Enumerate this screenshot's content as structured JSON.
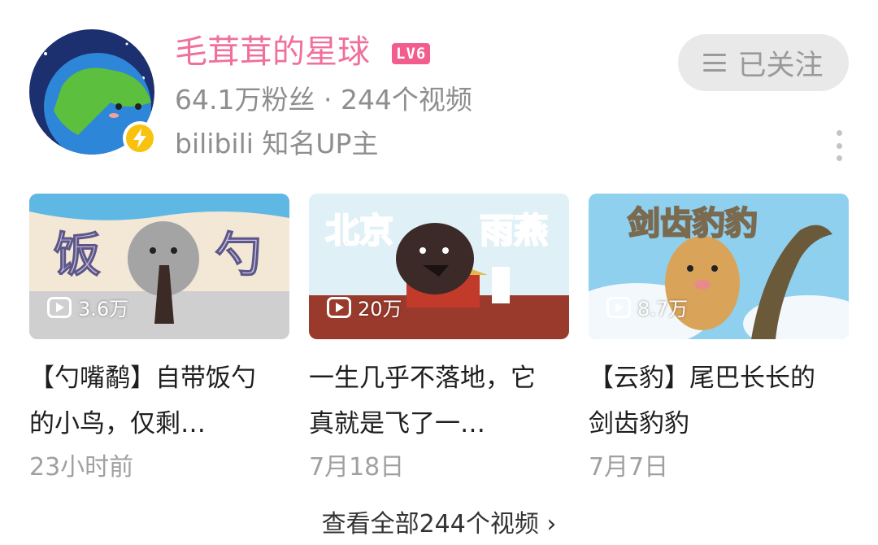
{
  "channel": {
    "name": "毛茸茸的星球",
    "level": "LV6",
    "stats": "64.1万粉丝 · 244个视频",
    "verification": "bilibili 知名UP主",
    "badge_icon": "lightning-icon",
    "follow_label": "已关注"
  },
  "videos": [
    {
      "thumb_text": [
        "饭",
        "勺"
      ],
      "views": "3.6万",
      "title": "【勺嘴鹬】自带饭勺的小鸟，仅剩…",
      "date": "23小时前"
    },
    {
      "thumb_text": [
        "北京",
        "雨燕"
      ],
      "views": "20万",
      "title": "一生几乎不落地，它真就是飞了一…",
      "date": "7月18日"
    },
    {
      "thumb_text": [
        "剑齿豹豹"
      ],
      "views": "8.7万",
      "title": "【云豹】尾巴长长的剑齿豹豹",
      "date": "7月7日"
    }
  ],
  "view_all": "查看全部244个视频 ›",
  "colors": {
    "name_pink": "#f0709b",
    "level_badge": "#f25d8e",
    "muted_text": "#8e8e8e",
    "follow_bg": "#e9e9e9"
  }
}
